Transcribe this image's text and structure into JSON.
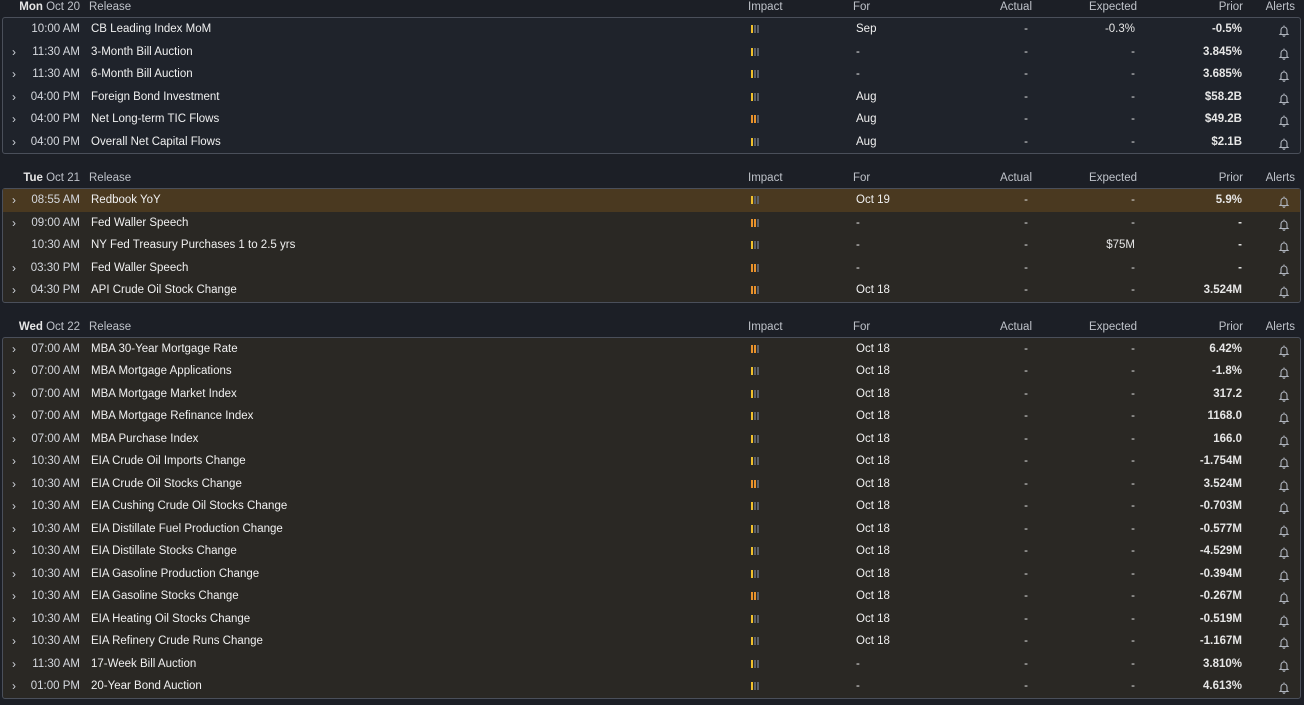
{
  "columns": {
    "release": "Release",
    "impact": "Impact",
    "for": "For",
    "actual": "Actual",
    "expected": "Expected",
    "prior": "Prior",
    "alerts": "Alerts"
  },
  "colors": {
    "impact_low": "#f0c02c",
    "impact_med": "#e8922c",
    "highlight": "#4a3920"
  },
  "groups": [
    {
      "day": "Mon",
      "date": "Oct 20",
      "style": "dark",
      "rows": [
        {
          "chev": false,
          "time": "10:00 AM",
          "release": "CB Leading Index MoM",
          "impact": 1,
          "for": "Sep",
          "actual": "-",
          "expected": "-0.3%",
          "prior": "-0.5%"
        },
        {
          "chev": true,
          "time": "11:30 AM",
          "release": "3-Month Bill Auction",
          "impact": 1,
          "for": "-",
          "actual": "-",
          "expected": "-",
          "prior": "3.845%"
        },
        {
          "chev": true,
          "time": "11:30 AM",
          "release": "6-Month Bill Auction",
          "impact": 1,
          "for": "-",
          "actual": "-",
          "expected": "-",
          "prior": "3.685%"
        },
        {
          "chev": true,
          "time": "04:00 PM",
          "release": "Foreign Bond Investment",
          "impact": 1,
          "for": "Aug",
          "actual": "-",
          "expected": "-",
          "prior": "$58.2B"
        },
        {
          "chev": true,
          "time": "04:00 PM",
          "release": "Net Long-term TIC Flows",
          "impact": 2,
          "for": "Aug",
          "actual": "-",
          "expected": "-",
          "prior": "$49.2B"
        },
        {
          "chev": true,
          "time": "04:00 PM",
          "release": "Overall Net Capital Flows",
          "impact": 1,
          "for": "Aug",
          "actual": "-",
          "expected": "-",
          "prior": "$2.1B"
        }
      ]
    },
    {
      "day": "Tue",
      "date": "Oct 21",
      "style": "tint",
      "rows": [
        {
          "chev": true,
          "hl": true,
          "time": "08:55 AM",
          "release": "Redbook YoY",
          "impact": 1,
          "for": "Oct 19",
          "actual": "-",
          "expected": "-",
          "prior": "5.9%"
        },
        {
          "chev": true,
          "time": "09:00 AM",
          "release": "Fed Waller Speech",
          "impact": 2,
          "for": "-",
          "actual": "-",
          "expected": "-",
          "prior": "-"
        },
        {
          "chev": false,
          "time": "10:30 AM",
          "release": "NY Fed Treasury Purchases 1 to 2.5 yrs",
          "impact": 1,
          "for": "-",
          "actual": "-",
          "expected": "$75M",
          "prior": "-"
        },
        {
          "chev": true,
          "time": "03:30 PM",
          "release": "Fed Waller Speech",
          "impact": 2,
          "for": "-",
          "actual": "-",
          "expected": "-",
          "prior": "-"
        },
        {
          "chev": true,
          "time": "04:30 PM",
          "release": "API Crude Oil Stock Change",
          "impact": 2,
          "for": "Oct 18",
          "actual": "-",
          "expected": "-",
          "prior": "3.524M"
        }
      ]
    },
    {
      "day": "Wed",
      "date": "Oct 22",
      "style": "tint",
      "rows": [
        {
          "chev": true,
          "time": "07:00 AM",
          "release": "MBA 30-Year Mortgage Rate",
          "impact": 2,
          "for": "Oct 18",
          "actual": "-",
          "expected": "-",
          "prior": "6.42%"
        },
        {
          "chev": true,
          "time": "07:00 AM",
          "release": "MBA Mortgage Applications",
          "impact": 1,
          "for": "Oct 18",
          "actual": "-",
          "expected": "-",
          "prior": "-1.8%"
        },
        {
          "chev": true,
          "time": "07:00 AM",
          "release": "MBA Mortgage Market Index",
          "impact": 1,
          "for": "Oct 18",
          "actual": "-",
          "expected": "-",
          "prior": "317.2"
        },
        {
          "chev": true,
          "time": "07:00 AM",
          "release": "MBA Mortgage Refinance Index",
          "impact": 1,
          "for": "Oct 18",
          "actual": "-",
          "expected": "-",
          "prior": "1168.0"
        },
        {
          "chev": true,
          "time": "07:00 AM",
          "release": "MBA Purchase Index",
          "impact": 1,
          "for": "Oct 18",
          "actual": "-",
          "expected": "-",
          "prior": "166.0"
        },
        {
          "chev": true,
          "time": "10:30 AM",
          "release": "EIA Crude Oil Imports Change",
          "impact": 1,
          "for": "Oct 18",
          "actual": "-",
          "expected": "-",
          "prior": "-1.754M"
        },
        {
          "chev": true,
          "time": "10:30 AM",
          "release": "EIA Crude Oil Stocks Change",
          "impact": 2,
          "for": "Oct 18",
          "actual": "-",
          "expected": "-",
          "prior": "3.524M"
        },
        {
          "chev": true,
          "time": "10:30 AM",
          "release": "EIA Cushing Crude Oil Stocks Change",
          "impact": 1,
          "for": "Oct 18",
          "actual": "-",
          "expected": "-",
          "prior": "-0.703M"
        },
        {
          "chev": true,
          "time": "10:30 AM",
          "release": "EIA Distillate Fuel Production Change",
          "impact": 1,
          "for": "Oct 18",
          "actual": "-",
          "expected": "-",
          "prior": "-0.577M"
        },
        {
          "chev": true,
          "time": "10:30 AM",
          "release": "EIA Distillate Stocks Change",
          "impact": 1,
          "for": "Oct 18",
          "actual": "-",
          "expected": "-",
          "prior": "-4.529M"
        },
        {
          "chev": true,
          "time": "10:30 AM",
          "release": "EIA Gasoline Production Change",
          "impact": 1,
          "for": "Oct 18",
          "actual": "-",
          "expected": "-",
          "prior": "-0.394M"
        },
        {
          "chev": true,
          "time": "10:30 AM",
          "release": "EIA Gasoline Stocks Change",
          "impact": 2,
          "for": "Oct 18",
          "actual": "-",
          "expected": "-",
          "prior": "-0.267M"
        },
        {
          "chev": true,
          "time": "10:30 AM",
          "release": "EIA Heating Oil Stocks Change",
          "impact": 1,
          "for": "Oct 18",
          "actual": "-",
          "expected": "-",
          "prior": "-0.519M"
        },
        {
          "chev": true,
          "time": "10:30 AM",
          "release": "EIA Refinery Crude Runs Change",
          "impact": 1,
          "for": "Oct 18",
          "actual": "-",
          "expected": "-",
          "prior": "-1.167M"
        },
        {
          "chev": true,
          "time": "11:30 AM",
          "release": "17-Week Bill Auction",
          "impact": 1,
          "for": "-",
          "actual": "-",
          "expected": "-",
          "prior": "3.810%"
        },
        {
          "chev": true,
          "time": "01:00 PM",
          "release": "20-Year Bond Auction",
          "impact": 1,
          "for": "-",
          "actual": "-",
          "expected": "-",
          "prior": "4.613%"
        }
      ]
    }
  ]
}
